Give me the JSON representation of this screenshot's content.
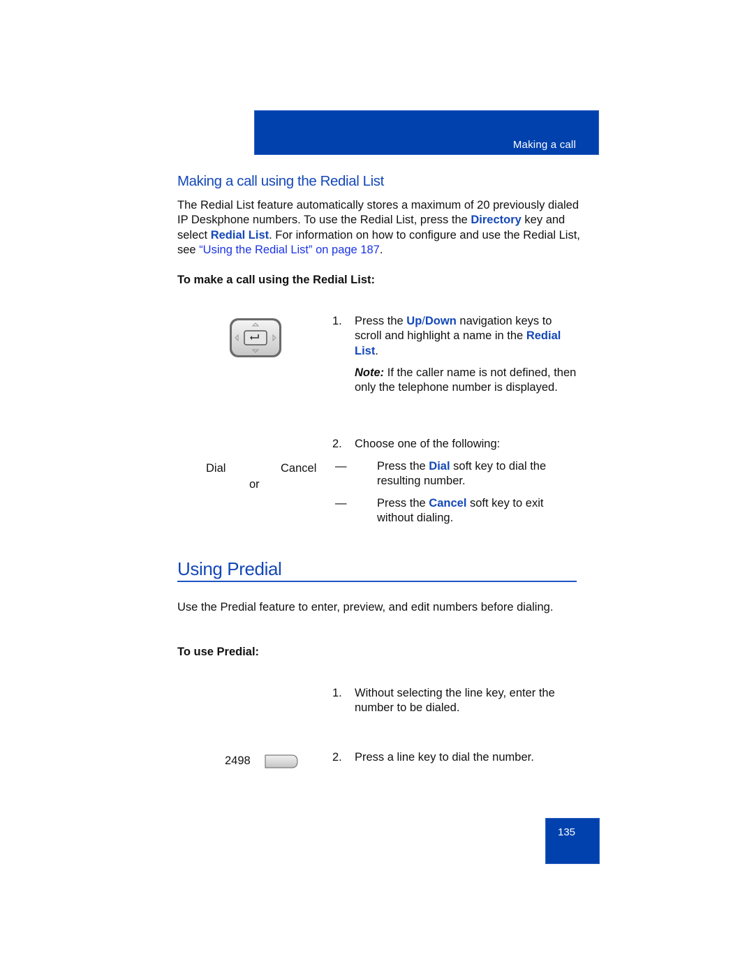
{
  "header": {
    "section_title": "Making a call"
  },
  "redial": {
    "heading": "Making a call using the Redial List",
    "intro": {
      "part1": "The Redial List feature automatically stores a maximum of 20 previously dialed IP Deskphone numbers. To use the Redial List, press the ",
      "directory": "Directory",
      "part2": " key and select ",
      "redial_list": "Redial List",
      "part3": ". For information on how to configure and use the Redial List, see ",
      "link": "“Using the Redial List” on page 187",
      "part4": "."
    },
    "procedure_heading": "To make a call using the Redial List:",
    "nav_key_icon": "navigation-key-icon",
    "steps": [
      {
        "number": "1.",
        "pre": "Press the ",
        "up": "Up",
        "slash": "/",
        "down": "Down",
        "mid": " navigation keys to scroll and highlight a name in the ",
        "redial_list": "Redial List",
        "post": ".",
        "note_label": "Note:",
        "note_text": " If the caller name is not defined, then only the telephone number is displayed."
      },
      {
        "number": "2.",
        "text": "Choose one of the following:",
        "options": [
          {
            "dash": "—",
            "pre": "Press the ",
            "key": "Dial",
            "post": " soft key to dial the resulting number."
          },
          {
            "dash": "—",
            "pre": "Press the ",
            "key": "Cancel",
            "post": " soft key to exit without dialing."
          }
        ]
      }
    ],
    "softkeys": {
      "dial": "Dial",
      "or": "or",
      "cancel": "Cancel"
    }
  },
  "predial": {
    "heading": "Using Predial",
    "intro": "Use the Predial feature to enter, preview, and edit numbers before dialing.",
    "procedure_heading": "To use Predial:",
    "steps": [
      {
        "number": "1.",
        "text": "Without selecting the line key, enter the number to be dialed."
      },
      {
        "number": "2.",
        "text": "Press a line key to dial the number."
      }
    ],
    "line_key_label": "2498",
    "line_key_icon": "line-key-icon"
  },
  "footer": {
    "page_number": "135"
  },
  "colors": {
    "brand_blue": "#0041ad",
    "heading_blue": "#1448b8",
    "link_blue": "#1a33e6"
  }
}
